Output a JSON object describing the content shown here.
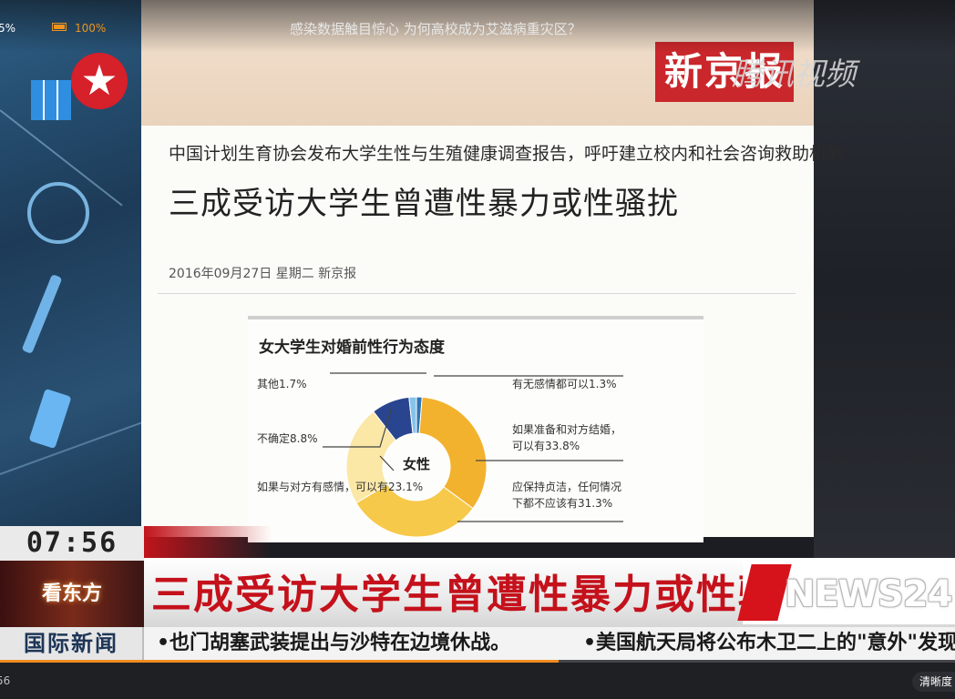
{
  "player": {
    "left_percent": "5%",
    "battery_percent": "100%",
    "video_title": "感染数据触目惊心 为何高校成为艾滋病重灾区？",
    "time_fragment": "56",
    "quality_label": "清晰度",
    "progress_fraction": 0.585,
    "accent_color": "#f08c1d"
  },
  "broadcast": {
    "clock": "07:56",
    "program_logo": "看东方",
    "banner_headline": "三成受访大学生曾遭性暴力或性骚扰",
    "channel_logo": "NEWS24",
    "ticker_label": "国际新闻",
    "ticker_items": [
      "•也门胡塞武装提出与沙特在边境休战。",
      "•美国航天局将公布木卫二上的\"意外\"发现。"
    ],
    "brand_red": "#c4111b"
  },
  "newspaper": {
    "masthead": "新京报",
    "watermark": "腾讯视频",
    "kicker": "中国计划生育协会发布大学生性与生殖健康调查报告，呼吁建立校内和社会咨询救助机制",
    "headline": "三成受访大学生曾遭性暴力或性骚扰",
    "dateline": "2016年09月27日  星期二  新京报"
  },
  "chart_data": {
    "type": "pie",
    "title": "女大学生对婚前性行为态度",
    "center_label": "女性",
    "slices": [
      {
        "label": "有无感情都可以",
        "value": 1.3,
        "value_label": "1.3%",
        "color": "#2f74b5"
      },
      {
        "label": "如果准备和对方结婚，可以有",
        "value": 33.8,
        "value_label": "33.8%",
        "color": "#f3b22e"
      },
      {
        "label": "应保持贞洁，任何情况下都不应该有",
        "value": 31.3,
        "value_label": "31.3%",
        "color": "#f6c94a"
      },
      {
        "label": "如果与对方有感情，可以有",
        "value": 23.1,
        "value_label": "23.1%",
        "color": "#fbe7a6"
      },
      {
        "label": "不确定",
        "value": 8.8,
        "value_label": "8.8%",
        "color": "#29458f"
      },
      {
        "label": "其他",
        "value": 1.7,
        "value_label": "1.7%",
        "color": "#86c3ea"
      }
    ]
  }
}
